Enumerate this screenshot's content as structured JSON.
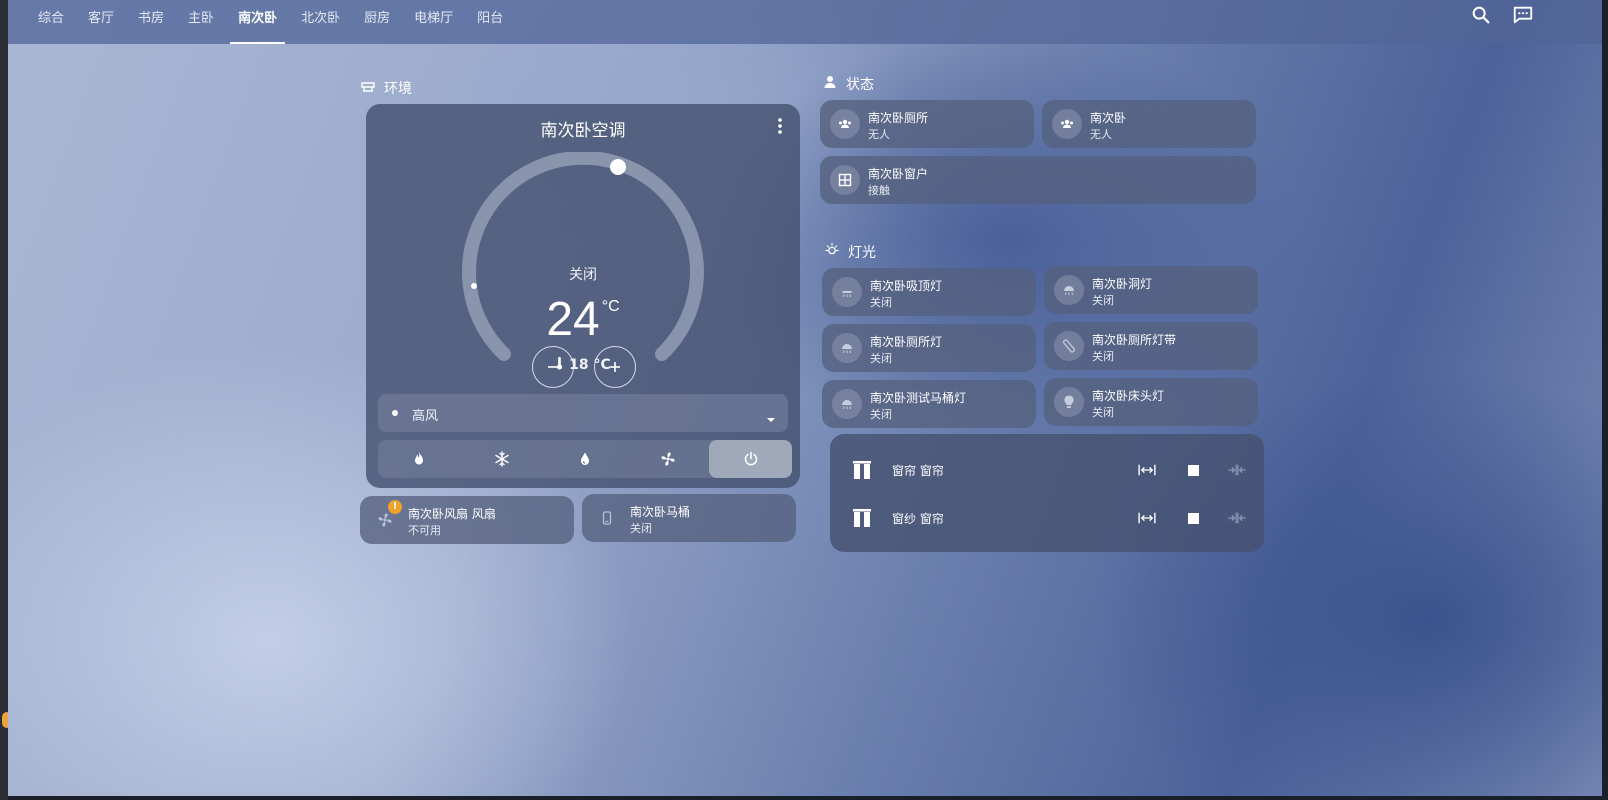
{
  "tabs": [
    {
      "label": "综合",
      "active": false
    },
    {
      "label": "客厅",
      "active": false
    },
    {
      "label": "书房",
      "active": false
    },
    {
      "label": "主卧",
      "active": false
    },
    {
      "label": "南次卧",
      "active": true
    },
    {
      "label": "北次卧",
      "active": false
    },
    {
      "label": "厨房",
      "active": false
    },
    {
      "label": "电梯厅",
      "active": false
    },
    {
      "label": "阳台",
      "active": false
    }
  ],
  "top_icons": [
    "search-icon",
    "chat-icon"
  ],
  "environment": {
    "title": "环境",
    "climate": {
      "name": "南次卧空调",
      "state": "关闭",
      "target_temp": "24",
      "unit": "°C",
      "current_temp": "18 °C",
      "fan_mode": "高风",
      "modes": [
        "heat-icon",
        "cool-icon",
        "dry-icon",
        "fan-icon",
        "power-icon"
      ],
      "active_mode": "power-icon"
    },
    "tiles": [
      {
        "name": "南次卧风扇 风扇",
        "state": "不可用",
        "icon": "fan-icon",
        "warning": "!"
      },
      {
        "name": "南次卧马桶",
        "state": "关闭",
        "icon": "toilet-icon"
      }
    ]
  },
  "status": {
    "title": "状态",
    "tiles": [
      {
        "name": "南次卧厕所",
        "state": "无人",
        "icon": "people-icon"
      },
      {
        "name": "南次卧",
        "state": "无人",
        "icon": "people-icon"
      },
      {
        "name": "南次卧窗户",
        "state": "接触",
        "icon": "window-icon"
      }
    ]
  },
  "lights": {
    "title": "灯光",
    "tiles": [
      {
        "name": "南次卧吸顶灯",
        "state": "关闭",
        "icon": "ceiling-light-icon"
      },
      {
        "name": "南次卧洞灯",
        "state": "关闭",
        "icon": "downlight-icon"
      },
      {
        "name": "南次卧厕所灯",
        "state": "关闭",
        "icon": "downlight-icon"
      },
      {
        "name": "南次卧厕所灯带",
        "state": "关闭",
        "icon": "led-strip-icon"
      },
      {
        "name": "南次卧测试马桶灯",
        "state": "关闭",
        "icon": "downlight-icon"
      },
      {
        "name": "南次卧床头灯",
        "state": "关闭",
        "icon": "bulb-icon"
      }
    ]
  },
  "covers": [
    {
      "name": "窗帘 窗帘",
      "icon": "curtain-icon"
    },
    {
      "name": "窗纱 窗帘",
      "icon": "curtain-icon"
    }
  ]
}
